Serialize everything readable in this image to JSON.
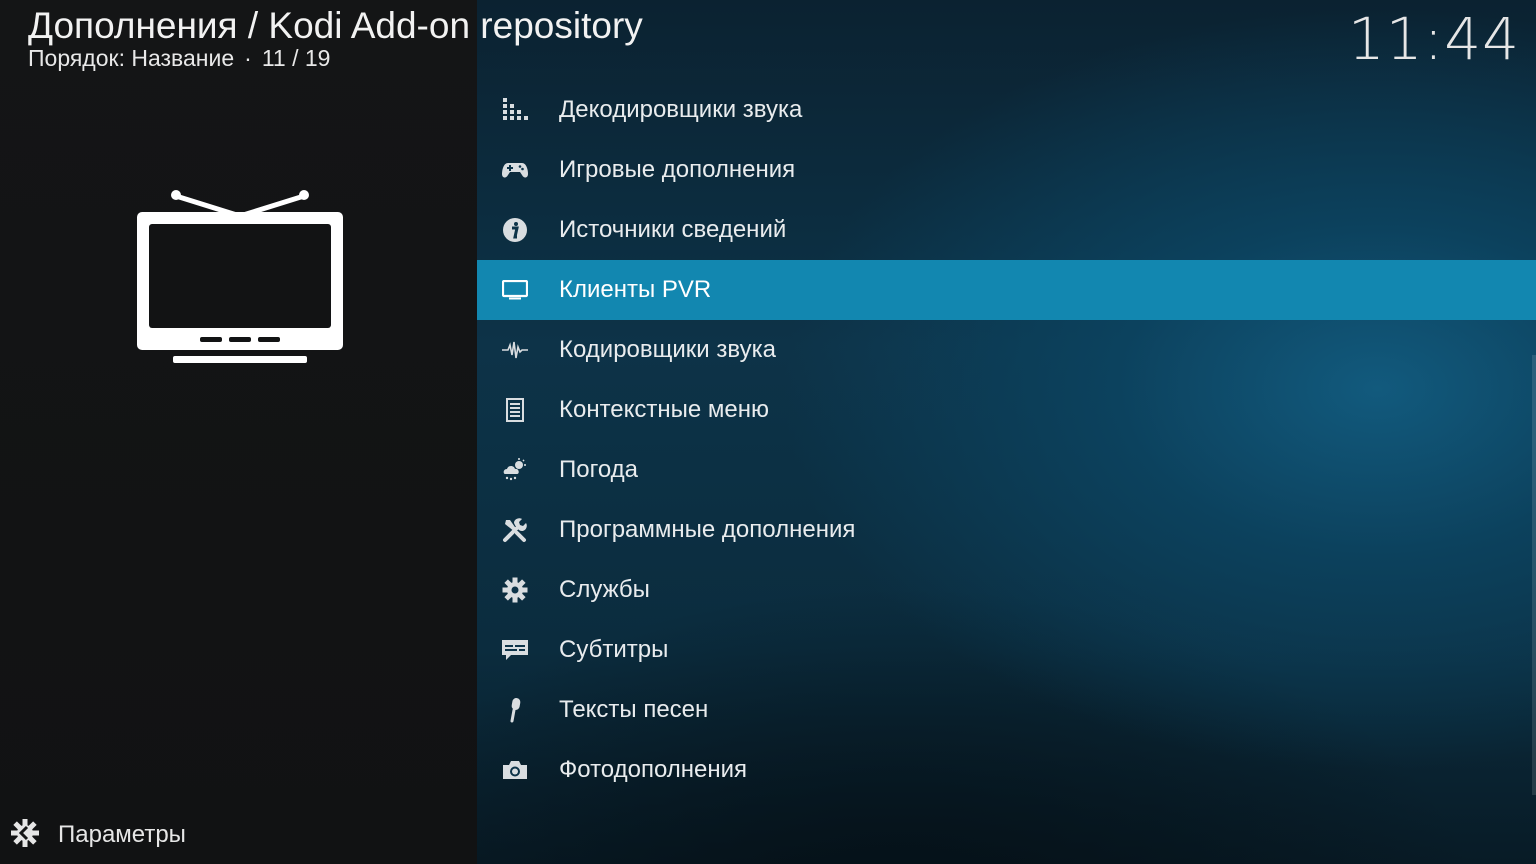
{
  "header": {
    "title": "Дополнения / Kodi Add-on repository",
    "sort_label": "Порядок: Название",
    "separator": "·",
    "position": "11 / 19"
  },
  "clock": "11:44",
  "preview_icon": "tv-icon",
  "menu": {
    "items": [
      {
        "label": "Декодировщики звука",
        "icon": "audio-decoder-icon"
      },
      {
        "label": "Игровые дополнения",
        "icon": "gamepad-icon"
      },
      {
        "label": "Источники сведений",
        "icon": "info-icon"
      },
      {
        "label": "Клиенты PVR",
        "icon": "tv-icon",
        "focused": true
      },
      {
        "label": "Кодировщики звука",
        "icon": "waveform-icon"
      },
      {
        "label": "Контекстные меню",
        "icon": "context-menu-icon"
      },
      {
        "label": "Погода",
        "icon": "weather-icon"
      },
      {
        "label": "Программные дополнения",
        "icon": "tools-icon"
      },
      {
        "label": "Службы",
        "icon": "gear-icon"
      },
      {
        "label": "Субтитры",
        "icon": "subtitles-icon"
      },
      {
        "label": "Тексты песен",
        "icon": "microphone-icon"
      },
      {
        "label": "Фотодополнения",
        "icon": "camera-icon"
      }
    ]
  },
  "settings": {
    "label": "Параметры",
    "icon": "settings-icon"
  },
  "colors": {
    "focus": "#1287b0",
    "left_panel": "#141516",
    "right_panel": "#0d3348"
  }
}
